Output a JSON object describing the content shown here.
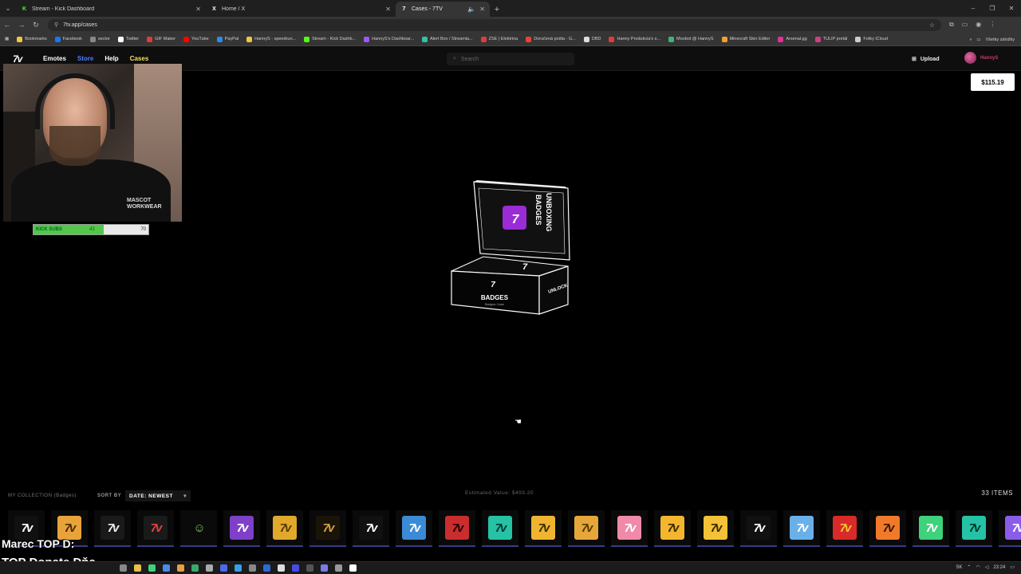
{
  "browser": {
    "tabs": [
      {
        "title": "Stream - Kick Dashboard",
        "icon": "kick-icon",
        "color": "#53fc18",
        "active": false
      },
      {
        "title": "Home / X",
        "icon": "x-icon",
        "color": "#ffffff",
        "active": false
      },
      {
        "title": "Cases - 7TV",
        "icon": "7tv-icon",
        "color": "#ffffff",
        "active": true
      }
    ],
    "url": "7tv.app/cases",
    "bookmarks": [
      {
        "label": "Bookmarks",
        "color": "#f5c542"
      },
      {
        "label": "Facebook",
        "color": "#1877f2"
      },
      {
        "label": "sector",
        "color": "#888888"
      },
      {
        "label": "Twitter",
        "color": "#ffffff"
      },
      {
        "label": "GIF Maker",
        "color": "#e03c3c"
      },
      {
        "label": "YouTube",
        "color": "#ff0000"
      },
      {
        "label": "PayPal",
        "color": "#2c8be8"
      },
      {
        "label": "HannyS - speedrun...",
        "color": "#f5c542"
      },
      {
        "label": "Stream - Kick Dashb...",
        "color": "#53fc18"
      },
      {
        "label": "HannyS's Dashboar...",
        "color": "#9b59f5"
      },
      {
        "label": "Alert Box / Streamla...",
        "color": "#31c3a2"
      },
      {
        "label": "ZSE | Elektrina",
        "color": "#e03c3c"
      },
      {
        "label": "Doručená pošta - G...",
        "color": "#ea4335"
      },
      {
        "label": "DBD",
        "color": "#dddddd"
      },
      {
        "label": "Hanny Produkcia's s...",
        "color": "#e03c3c"
      },
      {
        "label": "Moobot @ HannyS",
        "color": "#3ab57a"
      },
      {
        "label": "Minecraft Skin Editor",
        "color": "#f0a030"
      },
      {
        "label": "Arsenal.gg",
        "color": "#e0309a"
      },
      {
        "label": "TULIP portál",
        "color": "#d04080"
      },
      {
        "label": "Fotky iCloud",
        "color": "#cccccc"
      }
    ],
    "bookmarks_right": "Všetky záložky"
  },
  "site": {
    "logo": "7v",
    "nav": [
      {
        "label": "Emotes",
        "color": "#ffffff"
      },
      {
        "label": "Store",
        "color": "#4f7cff"
      },
      {
        "label": "Help",
        "color": "#ffffff"
      },
      {
        "label": "Cases",
        "color": "#f6e05e"
      }
    ],
    "search_placeholder": "Search",
    "upload_label": "Upload",
    "username": "HannyS",
    "balance": "$115.19"
  },
  "stream_overlay": {
    "sub_goal_label": "KICK SUBS",
    "sub_current": "43",
    "sub_goal": "70",
    "sub_progress": 0.614,
    "shirt_text_1": "MASCOT",
    "shirt_text_2": "WORKWEAR",
    "donor_line_1": "Marec TOP D:",
    "donor_line_2": "TOP Donate Dňa -"
  },
  "case": {
    "lid_text_1": "UNBOXING",
    "lid_text_2": "BADGES",
    "front_text": "BADGES",
    "front_subtext": "Badges Case",
    "side_text": "UNLOCK"
  },
  "collection": {
    "title": "MY COLLECTION (Badges)",
    "sort_label": "SORT BY",
    "sort_value": "DATE: NEWEST",
    "estimated_value": "Estimated Value: $493.20",
    "items_count": "33 ITEMS",
    "badges": [
      {
        "glyph": "7v",
        "bg": "#111111",
        "fg": "#ffffff"
      },
      {
        "glyph": "7v",
        "bg": "#e8a33a",
        "fg": "#4a2a00"
      },
      {
        "glyph": "7v",
        "bg": "#1a1a1a",
        "fg": "#f0f0f0"
      },
      {
        "glyph": "7v",
        "bg": "#1a1a1a",
        "fg": "#e34040"
      },
      {
        "glyph": "☺",
        "bg": "#0a0a0a",
        "fg": "#7ad35a"
      },
      {
        "glyph": "7v",
        "bg": "#7e3fc9",
        "fg": "#ffffff"
      },
      {
        "glyph": "7v",
        "bg": "#e0a92c",
        "fg": "#5a3a00"
      },
      {
        "glyph": "7v",
        "bg": "#1a1408",
        "fg": "#d7a441"
      },
      {
        "glyph": "7v",
        "bg": "#111111",
        "fg": "#ffffff"
      },
      {
        "glyph": "7v",
        "bg": "#3b8ad6",
        "fg": "#ffffff"
      },
      {
        "glyph": "7v",
        "bg": "#c92d2d",
        "fg": "#2a0000"
      },
      {
        "glyph": "7v",
        "bg": "#25c2a6",
        "fg": "#003a2e"
      },
      {
        "glyph": "7v",
        "bg": "#f0b530",
        "fg": "#402a00"
      },
      {
        "glyph": "7v",
        "bg": "#e6a73a",
        "fg": "#5a3a00"
      },
      {
        "glyph": "7v",
        "bg": "#f08aa8",
        "fg": "#ffffff"
      },
      {
        "glyph": "7v",
        "bg": "#f3b62e",
        "fg": "#3a2600"
      },
      {
        "glyph": "7v",
        "bg": "#f5c237",
        "fg": "#3a2600"
      },
      {
        "glyph": "7v",
        "bg": "#111111",
        "fg": "#ffffff"
      },
      {
        "glyph": "7v",
        "bg": "#6ab0e8",
        "fg": "#ffffff"
      },
      {
        "glyph": "7v",
        "bg": "#d92a2a",
        "fg": "#f5c237"
      },
      {
        "glyph": "7v",
        "bg": "#f07a2a",
        "fg": "#3a1400"
      },
      {
        "glyph": "7v",
        "bg": "#3ed27a",
        "fg": "#ffffff"
      },
      {
        "glyph": "7v",
        "bg": "#25c2a6",
        "fg": "#003a2e"
      },
      {
        "glyph": "7v",
        "bg": "#8a5ce8",
        "fg": "#ffffff"
      }
    ]
  },
  "taskbar": {
    "lang": "SK",
    "time": "23:24"
  }
}
